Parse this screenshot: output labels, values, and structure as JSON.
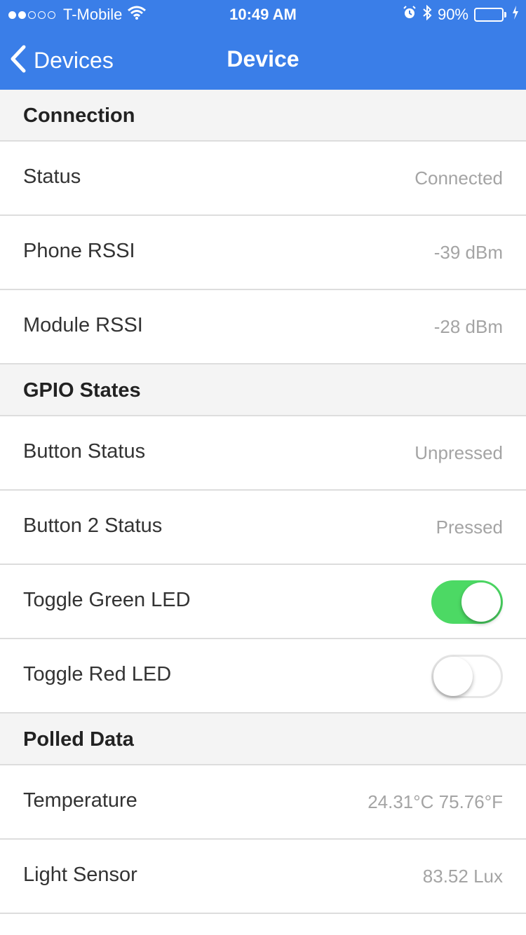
{
  "status_bar": {
    "carrier": "T-Mobile",
    "time": "10:49 AM",
    "battery": "90%",
    "battery_level": 0.9,
    "signal_bars": 2,
    "icons": [
      "wifi-icon",
      "alarm-icon",
      "bluetooth-icon",
      "battery-icon",
      "charging-icon"
    ]
  },
  "navbar": {
    "back_label": "Devices",
    "title": "Device",
    "background": "#3a7ee8"
  },
  "sections": {
    "connection": {
      "title": "Connection",
      "rows": [
        {
          "label": "Status",
          "value": "Connected"
        },
        {
          "label": "Phone RSSI",
          "value": "-39 dBm"
        },
        {
          "label": "Module RSSI",
          "value": "-28 dBm"
        }
      ]
    },
    "gpio": {
      "title": "GPIO States",
      "rows": [
        {
          "label": "Button Status",
          "value": "Unpressed"
        },
        {
          "label": "Button 2 Status",
          "value": "Pressed"
        },
        {
          "label": "Toggle Green LED",
          "toggle": true
        },
        {
          "label": "Toggle Red LED",
          "toggle": false
        }
      ]
    },
    "polled": {
      "title": "Polled Data",
      "rows": [
        {
          "label": "Temperature",
          "value": "24.31°C 75.76°F"
        },
        {
          "label": "Light Sensor",
          "value": "83.52 Lux"
        }
      ]
    }
  },
  "colors": {
    "accent": "#3a7ee8",
    "toggle_on": "#4cd964",
    "value_text": "#a4a4a4"
  }
}
